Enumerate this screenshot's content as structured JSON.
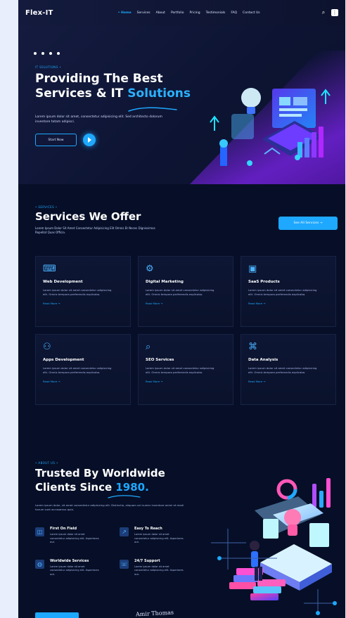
{
  "header": {
    "logo": "Flex-IT",
    "nav": [
      "• Home",
      "Services",
      "About",
      "Portfolio",
      "Pricing",
      "Testimonials",
      "FAQ",
      "Contact Us"
    ],
    "right_icons": [
      "search-icon",
      "grid-icon"
    ]
  },
  "hero": {
    "social": [
      "facebook-icon",
      "youtube-icon",
      "instagram-icon",
      "twitter-icon"
    ],
    "tag": "IT SOLUTIONS •",
    "title_line1": "Providing The Best",
    "title_line2_prefix": "Services & IT ",
    "title_line2_highlight": "Solutions",
    "copy": "Lorem ipsum dolor sit amet, consectetur adipisicing elit. Sed architecto dolorum inventore totam adipisci.",
    "primary_button": "Start Now"
  },
  "services": {
    "tag": "• SERVICES •",
    "title": "Services We Offer",
    "copy": "Lorem Ipsum Dolor Sit Amet Consectetur Adipisicing Elit Omnis Et Neces Dignissimos Repellat Quas Officia.",
    "see_all": "See All Services →",
    "cards": [
      {
        "icon": "code-window-icon",
        "title": "Web Development",
        "copy": "Lorem ipsum dolor sit amet consectetur adipisicing elit. Omnis tempora perferendis explicabo.",
        "link": "Read More →"
      },
      {
        "icon": "gear-network-icon",
        "title": "Digital Marketing",
        "copy": "Lorem ipsum dolor sit amet consectetur adipisicing elit. Omnis tempora perferendis explicabo.",
        "link": "Read More →"
      },
      {
        "icon": "dashboard-icon",
        "title": "SaaS Products",
        "copy": "Lorem ipsum dolor sit amet consectetur adipisicing elit. Omnis tempora perferendis explicabo.",
        "link": "Read More →"
      },
      {
        "icon": "app-users-icon",
        "title": "Apps Development",
        "copy": "Lorem ipsum dolor sit amet consectetur adipisicing elit. Omnis tempora perferendis explicabo.",
        "link": "Read More →"
      },
      {
        "icon": "search-icon",
        "title": "SEO Services",
        "copy": "Lorem ipsum dolor sit amet consectetur adipisicing elit. Omnis tempora perferendis explicabo.",
        "link": "Read More →"
      },
      {
        "icon": "data-analysis-icon",
        "title": "Data Analysis",
        "copy": "Lorem ipsum dolor sit amet consectetur adipisicing elit. Omnis tempora perferendis explicabo.",
        "link": "Read More →"
      }
    ]
  },
  "about": {
    "tag": "• ABOUT US •",
    "title_line1": "Trusted By Worldwide",
    "title_line2_prefix": "Clients Since ",
    "title_line2_year": "1980.",
    "copy": "Lorem ipsum dolor, sit amet consectetur adipisicing elit. Distinctio, aliquam vel numer inventore animi et modi harum sunt accusamus quia.",
    "features": [
      {
        "icon": "layers-icon",
        "title": "First On Field",
        "copy": "Lorem ipsum dolor sit amet consectetur adipisicing elit. Asperiores aut."
      },
      {
        "icon": "rocket-icon",
        "title": "Easy To Reach",
        "copy": "Lorem ipsum dolor sit amet consectetur adipisicing elit. Asperiores aut."
      },
      {
        "icon": "globe-icon",
        "title": "Worldwide Services",
        "copy": "Lorem ipsum dolor sit amet consectetur adipisicing elit. Asperiores aut."
      },
      {
        "icon": "support-icon",
        "title": "24/7 Support",
        "copy": "Lorem ipsum dolor sit amet consectetur adipisicing elit. Asperiores aut."
      }
    ],
    "signature": "Amir Thomas"
  }
}
